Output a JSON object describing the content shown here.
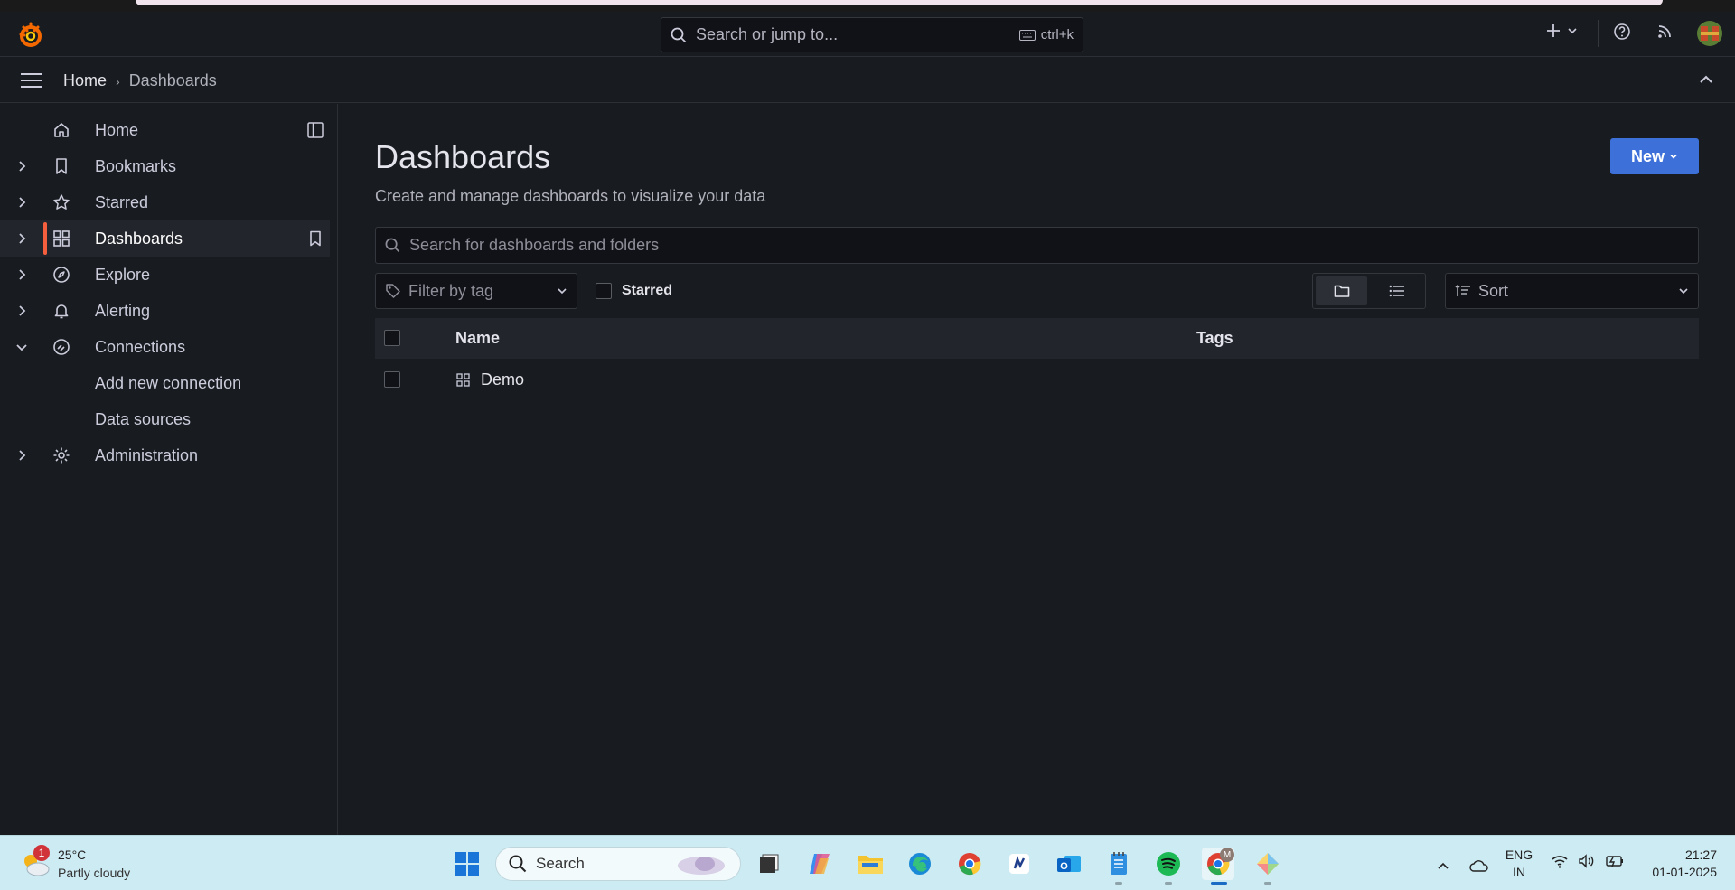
{
  "topbar": {
    "search_placeholder": "Search or jump to...",
    "shortcut": "ctrl+k"
  },
  "breadcrumb": {
    "home": "Home",
    "separator": "›",
    "current": "Dashboards"
  },
  "sidebar": {
    "items": [
      {
        "label": "Home",
        "icon": "home-icon",
        "expandable": false
      },
      {
        "label": "Bookmarks",
        "icon": "bookmark-icon",
        "expandable": true
      },
      {
        "label": "Starred",
        "icon": "star-icon",
        "expandable": true
      },
      {
        "label": "Dashboards",
        "icon": "dashboards-grid-icon",
        "expandable": true,
        "active": true
      },
      {
        "label": "Explore",
        "icon": "compass-icon",
        "expandable": true
      },
      {
        "label": "Alerting",
        "icon": "bell-icon",
        "expandable": true
      },
      {
        "label": "Connections",
        "icon": "connections-icon",
        "expandable": true,
        "expanded": true
      },
      {
        "label": "Add new connection",
        "sub": true
      },
      {
        "label": "Data sources",
        "sub": true
      },
      {
        "label": "Administration",
        "icon": "gear-icon",
        "expandable": true
      }
    ]
  },
  "main": {
    "title": "Dashboards",
    "subtitle": "Create and manage dashboards to visualize your data",
    "new_button": "New",
    "search_placeholder": "Search for dashboards and folders",
    "tag_filter_placeholder": "Filter by tag",
    "starred_label": "Starred",
    "sort_placeholder": "Sort",
    "table": {
      "columns": [
        "Name",
        "Tags"
      ],
      "rows": [
        {
          "name": "Demo",
          "tags": ""
        }
      ]
    }
  },
  "taskbar": {
    "weather_temp": "25°C",
    "weather_condition": "Partly cloudy",
    "weather_badge": "1",
    "search_placeholder": "Search",
    "lang_line1": "ENG",
    "lang_line2": "IN",
    "time": "21:27",
    "date": "01-01-2025",
    "chrome_badge": "M"
  },
  "colors": {
    "accent": "#3d71d9",
    "active_bar": "#f55f3e",
    "background": "#181b1f"
  }
}
